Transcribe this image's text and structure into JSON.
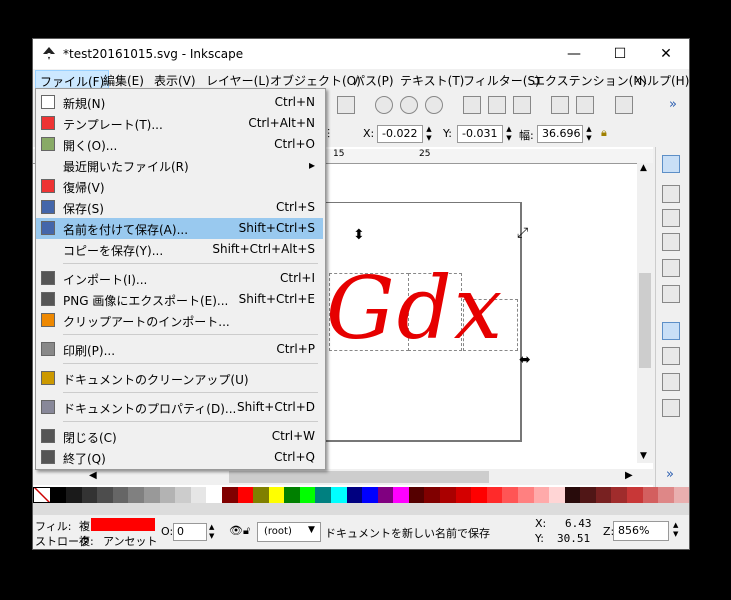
{
  "window": {
    "title": "*test20161015.svg - Inkscape",
    "minimize": "—",
    "maximize": "☐",
    "close": "✕"
  },
  "menubar": [
    {
      "label": "ファイル(F)",
      "active": true
    },
    {
      "label": "編集(E)"
    },
    {
      "label": "表示(V)"
    },
    {
      "label": "レイヤー(L)"
    },
    {
      "label": "オブジェクト(O)"
    },
    {
      "label": "パス(P)"
    },
    {
      "label": "テキスト(T)"
    },
    {
      "label": "フィルター(S)"
    },
    {
      "label": "エクステンション(N)"
    },
    {
      "label": "ヘルプ(H)"
    }
  ],
  "toolbar2": {
    "x_label": "X:",
    "x_value": "-0.022",
    "y_label": "Y:",
    "y_value": "-0.031",
    "w_label": "幅:",
    "w_value": "36.696",
    "more": "»"
  },
  "file_menu": [
    {
      "icon": "new-icon",
      "label": "新規(N)",
      "shortcut": "Ctrl+N"
    },
    {
      "icon": "template-icon",
      "label": "テンプレート(T)...",
      "shortcut": "Ctrl+Alt+N"
    },
    {
      "icon": "open-icon",
      "label": "開く(O)...",
      "shortcut": "Ctrl+O"
    },
    {
      "icon": "",
      "label": "最近開いたファイル(R)",
      "shortcut": "▸"
    },
    {
      "icon": "revert-icon",
      "label": "復帰(V)",
      "shortcut": ""
    },
    {
      "icon": "save-icon",
      "label": "保存(S)",
      "shortcut": "Ctrl+S"
    },
    {
      "icon": "save-as-icon",
      "label": "名前を付けて保存(A)...",
      "shortcut": "Shift+Ctrl+S",
      "highlight": true
    },
    {
      "icon": "",
      "label": "コピーを保存(Y)...",
      "shortcut": "Shift+Ctrl+Alt+S"
    },
    {
      "icon": "import-icon",
      "label": "インポート(I)...",
      "shortcut": "Ctrl+I"
    },
    {
      "icon": "export-icon",
      "label": "PNG 画像にエクスポート(E)...",
      "shortcut": "Shift+Ctrl+E"
    },
    {
      "icon": "clipart-icon",
      "label": "クリップアートのインポート...",
      "shortcut": ""
    },
    {
      "icon": "print-icon",
      "label": "印刷(P)...",
      "shortcut": "Ctrl+P"
    },
    {
      "icon": "cleanup-icon",
      "label": "ドキュメントのクリーンアップ(U)",
      "shortcut": ""
    },
    {
      "icon": "properties-icon",
      "label": "ドキュメントのプロパティ(D)...",
      "shortcut": "Shift+Ctrl+D"
    },
    {
      "icon": "close-doc-icon",
      "label": "閉じる(C)",
      "shortcut": "Ctrl+W"
    },
    {
      "icon": "quit-icon",
      "label": "終了(Q)",
      "shortcut": "Ctrl+Q"
    }
  ],
  "canvas": {
    "text": "Gdx",
    "text_color": "#e60000",
    "ruler_labels": [
      "15",
      "25"
    ]
  },
  "status": {
    "fill_label": "フィル:",
    "fill_value": "複",
    "stroke_label": "ストローク:",
    "stroke_value": "複",
    "stroke_extra": "アンセット",
    "fill_color": "#ff0000",
    "opacity_label": "O:",
    "opacity_value": "0",
    "layer_value": "(root)",
    "message": "ドキュメントを新しい名前で保存",
    "x_label": "X:",
    "x_value": "6.43",
    "y_label": "Y:",
    "y_value": "30.51",
    "z_label": "Z:",
    "zoom_value": "856%"
  },
  "palette_colors": [
    "#000000",
    "#1a1a1a",
    "#333333",
    "#4d4d4d",
    "#666666",
    "#808080",
    "#999999",
    "#b3b3b3",
    "#cccccc",
    "#e6e6e6",
    "#ffffff",
    "#800000",
    "#ff0000",
    "#808000",
    "#ffff00",
    "#008000",
    "#00ff00",
    "#008080",
    "#00ffff",
    "#000080",
    "#0000ff",
    "#800080",
    "#ff00ff",
    "#550000",
    "#800000",
    "#aa0000",
    "#d40000",
    "#ff0000",
    "#ff2a2a",
    "#ff5555",
    "#ff8080",
    "#ffaaaa",
    "#ffd5d5",
    "#280b0b",
    "#501616",
    "#782121",
    "#a02c2c",
    "#c83737",
    "#d35f5f",
    "#de8787",
    "#e9afaf"
  ]
}
